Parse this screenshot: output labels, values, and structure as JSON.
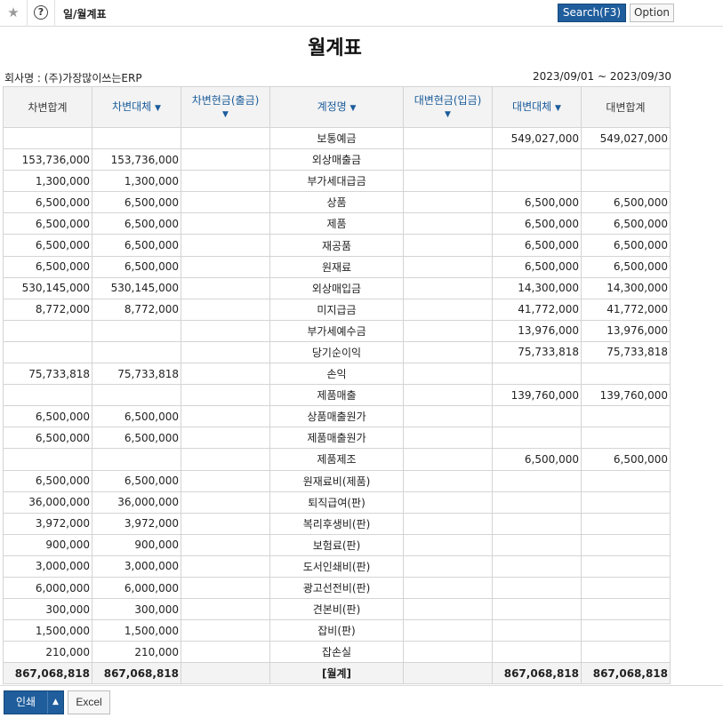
{
  "toolbar": {
    "star_icon": "star-icon",
    "help_icon": "question-circle-icon",
    "help_glyph": "?",
    "menu_title": "일/월계표",
    "search_label": "Search(F3)",
    "option_label": "Option"
  },
  "report": {
    "title": "월계표",
    "company": "회사명 : (주)가장많이쓰는ERP",
    "period": "2023/09/01 ~ 2023/09/30"
  },
  "columns": [
    {
      "label": "차변합계",
      "sortable": false
    },
    {
      "label": "차변대체",
      "sortable": true
    },
    {
      "label": "차변현금(출금)",
      "sortable": true
    },
    {
      "label": "계정명",
      "sortable": true
    },
    {
      "label": "대변현금(입금)",
      "sortable": true
    },
    {
      "label": "대변대체",
      "sortable": true
    },
    {
      "label": "대변합계",
      "sortable": false
    }
  ],
  "rows": [
    [
      "",
      "",
      "",
      "보통예금",
      "",
      "549,027,000",
      "549,027,000"
    ],
    [
      "153,736,000",
      "153,736,000",
      "",
      "외상매출금",
      "",
      "",
      ""
    ],
    [
      "1,300,000",
      "1,300,000",
      "",
      "부가세대급금",
      "",
      "",
      ""
    ],
    [
      "6,500,000",
      "6,500,000",
      "",
      "상품",
      "",
      "6,500,000",
      "6,500,000"
    ],
    [
      "6,500,000",
      "6,500,000",
      "",
      "제품",
      "",
      "6,500,000",
      "6,500,000"
    ],
    [
      "6,500,000",
      "6,500,000",
      "",
      "재공품",
      "",
      "6,500,000",
      "6,500,000"
    ],
    [
      "6,500,000",
      "6,500,000",
      "",
      "원재료",
      "",
      "6,500,000",
      "6,500,000"
    ],
    [
      "530,145,000",
      "530,145,000",
      "",
      "외상매입금",
      "",
      "14,300,000",
      "14,300,000"
    ],
    [
      "8,772,000",
      "8,772,000",
      "",
      "미지급금",
      "",
      "41,772,000",
      "41,772,000"
    ],
    [
      "",
      "",
      "",
      "부가세예수금",
      "",
      "13,976,000",
      "13,976,000"
    ],
    [
      "",
      "",
      "",
      "당기순이익",
      "",
      "75,733,818",
      "75,733,818"
    ],
    [
      "75,733,818",
      "75,733,818",
      "",
      "손익",
      "",
      "",
      ""
    ],
    [
      "",
      "",
      "",
      "제품매출",
      "",
      "139,760,000",
      "139,760,000"
    ],
    [
      "6,500,000",
      "6,500,000",
      "",
      "상품매출원가",
      "",
      "",
      ""
    ],
    [
      "6,500,000",
      "6,500,000",
      "",
      "제품매출원가",
      "",
      "",
      ""
    ],
    [
      "",
      "",
      "",
      "제품제조",
      "",
      "6,500,000",
      "6,500,000"
    ],
    [
      "6,500,000",
      "6,500,000",
      "",
      "원재료비(제품)",
      "",
      "",
      ""
    ],
    [
      "36,000,000",
      "36,000,000",
      "",
      "퇴직급여(판)",
      "",
      "",
      ""
    ],
    [
      "3,972,000",
      "3,972,000",
      "",
      "복리후생비(판)",
      "",
      "",
      ""
    ],
    [
      "900,000",
      "900,000",
      "",
      "보험료(판)",
      "",
      "",
      ""
    ],
    [
      "3,000,000",
      "3,000,000",
      "",
      "도서인쇄비(판)",
      "",
      "",
      ""
    ],
    [
      "6,000,000",
      "6,000,000",
      "",
      "광고선전비(판)",
      "",
      "",
      ""
    ],
    [
      "300,000",
      "300,000",
      "",
      "견본비(판)",
      "",
      "",
      ""
    ],
    [
      "1,500,000",
      "1,500,000",
      "",
      "잡비(판)",
      "",
      "",
      ""
    ],
    [
      "210,000",
      "210,000",
      "",
      "잡손실",
      "",
      "",
      ""
    ]
  ],
  "total": [
    "867,068,818",
    "867,068,818",
    "",
    "[월계]",
    "",
    "867,068,818",
    "867,068,818"
  ],
  "footer": {
    "print_label": "인쇄",
    "excel_label": "Excel"
  },
  "colors": {
    "accent": "#1f5d9c",
    "link": "#1b4f86",
    "header_bg": "#f3f3f3",
    "border": "#d4d4d4"
  }
}
